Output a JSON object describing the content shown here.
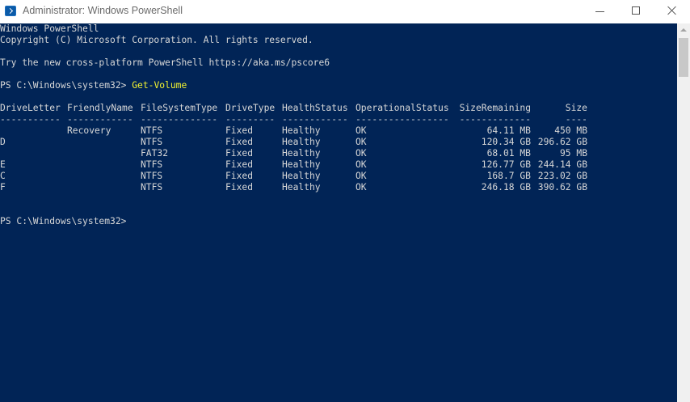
{
  "window": {
    "title": "Administrator: Windows PowerShell"
  },
  "console": {
    "banner": [
      "Windows PowerShell",
      "Copyright (C) Microsoft Corporation. All rights reserved.",
      "",
      "Try the new cross-platform PowerShell https://aka.ms/pscore6"
    ],
    "prompt": "PS C:\\Windows\\system32> ",
    "command": "Get-Volume",
    "table": {
      "headers": [
        "DriveLetter",
        "FriendlyName",
        "FileSystemType",
        "DriveType",
        "HealthStatus",
        "OperationalStatus",
        "SizeRemaining",
        "Size"
      ],
      "underlines": [
        "-----------",
        "------------",
        "--------------",
        "---------",
        "------------",
        "-----------------",
        "-------------",
        "----"
      ],
      "rows": [
        [
          "",
          "Recovery",
          "NTFS",
          "Fixed",
          "Healthy",
          "OK",
          "64.11 MB",
          "450 MB"
        ],
        [
          "D",
          "",
          "NTFS",
          "Fixed",
          "Healthy",
          "OK",
          "120.34 GB",
          "296.62 GB"
        ],
        [
          "",
          "",
          "FAT32",
          "Fixed",
          "Healthy",
          "OK",
          "68.01 MB",
          "95 MB"
        ],
        [
          "E",
          "",
          "NTFS",
          "Fixed",
          "Healthy",
          "OK",
          "126.77 GB",
          "244.14 GB"
        ],
        [
          "C",
          "",
          "NTFS",
          "Fixed",
          "Healthy",
          "OK",
          "168.7 GB",
          "223.02 GB"
        ],
        [
          "F",
          "",
          "NTFS",
          "Fixed",
          "Healthy",
          "OK",
          "246.18 GB",
          "390.62 GB"
        ]
      ]
    },
    "final_prompt": "PS C:\\Windows\\system32>"
  }
}
